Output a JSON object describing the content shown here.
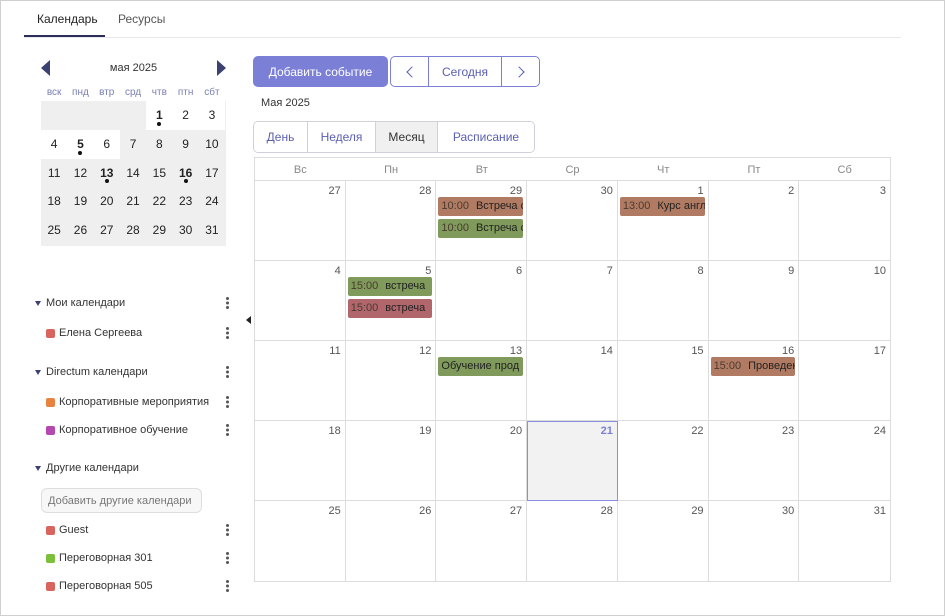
{
  "tabs": [
    {
      "label": "Календарь",
      "active": true
    },
    {
      "label": "Ресурсы",
      "active": false
    }
  ],
  "mini_calendar": {
    "title": "мая 2025",
    "weekdays": [
      "вск",
      "пнд",
      "втр",
      "срд",
      "чтв",
      "птн",
      "сбт"
    ],
    "days": [
      {
        "d": "",
        "cur": false
      },
      {
        "d": "",
        "cur": false
      },
      {
        "d": "",
        "cur": false
      },
      {
        "d": "",
        "cur": false
      },
      {
        "d": "1",
        "cur": true,
        "bold": true,
        "dot": true
      },
      {
        "d": "2",
        "cur": true
      },
      {
        "d": "3",
        "cur": true
      },
      {
        "d": "4",
        "cur": true
      },
      {
        "d": "5",
        "cur": true,
        "bold": true,
        "dot": true
      },
      {
        "d": "6",
        "cur": true
      },
      {
        "d": "7",
        "cur": false
      },
      {
        "d": "8",
        "cur": false
      },
      {
        "d": "9",
        "cur": false
      },
      {
        "d": "10",
        "cur": false
      },
      {
        "d": "11",
        "cur": false
      },
      {
        "d": "12",
        "cur": false
      },
      {
        "d": "13",
        "cur": false,
        "bold": true,
        "dot": true
      },
      {
        "d": "14",
        "cur": false
      },
      {
        "d": "15",
        "cur": false
      },
      {
        "d": "16",
        "cur": false,
        "bold": true,
        "dot": true
      },
      {
        "d": "17",
        "cur": false
      },
      {
        "d": "18",
        "cur": false
      },
      {
        "d": "19",
        "cur": false
      },
      {
        "d": "20",
        "cur": false
      },
      {
        "d": "21",
        "cur": false
      },
      {
        "d": "22",
        "cur": false
      },
      {
        "d": "23",
        "cur": false
      },
      {
        "d": "24",
        "cur": false
      },
      {
        "d": "25",
        "cur": false
      },
      {
        "d": "26",
        "cur": false
      },
      {
        "d": "27",
        "cur": false
      },
      {
        "d": "28",
        "cur": false
      },
      {
        "d": "29",
        "cur": false
      },
      {
        "d": "30",
        "cur": false
      },
      {
        "d": "31",
        "cur": false
      }
    ]
  },
  "sections": {
    "my": {
      "label": "Мои календари",
      "items": [
        {
          "label": "Елена Сергеева",
          "color": "#d9645e"
        }
      ]
    },
    "directum": {
      "label": "Directum календари",
      "items": [
        {
          "label": "Корпоративные мероприятия",
          "color": "#e8833f"
        },
        {
          "label": "Корпоративное обучение",
          "color": "#b548b0"
        }
      ]
    },
    "other": {
      "label": "Другие календари",
      "add_placeholder": "Добавить другие календари",
      "items": [
        {
          "label": "Guest",
          "color": "#d9645e"
        },
        {
          "label": "Переговорная 301",
          "color": "#7cbf3a"
        },
        {
          "label": "Переговорная 505",
          "color": "#d9645e"
        }
      ]
    }
  },
  "toolbar": {
    "add_event": "Добавить событие",
    "today": "Сегодня",
    "period_label": "Мая 2025"
  },
  "views": [
    {
      "label": "День",
      "active": false
    },
    {
      "label": "Неделя",
      "active": false
    },
    {
      "label": "Месяц",
      "active": true
    },
    {
      "label": "Расписание",
      "active": false
    }
  ],
  "month": {
    "weekdays": [
      "Вс",
      "Пн",
      "Вт",
      "Ср",
      "Чт",
      "Пт",
      "Сб"
    ],
    "today": "21",
    "days": [
      "27",
      "28",
      "29",
      "30",
      "1",
      "2",
      "3",
      "4",
      "5",
      "6",
      "7",
      "8",
      "9",
      "10",
      "11",
      "12",
      "13",
      "14",
      "15",
      "16",
      "17",
      "18",
      "19",
      "20",
      "21",
      "22",
      "23",
      "24",
      "25",
      "26",
      "27",
      "28",
      "29",
      "30",
      "31"
    ],
    "events": [
      {
        "cell": 2,
        "slot": 0,
        "time": "10:00",
        "title": "Встреча с",
        "color": "#b07b62"
      },
      {
        "cell": 2,
        "slot": 1,
        "time": "10:00",
        "title": "Встреча с",
        "color": "#7f9a5a"
      },
      {
        "cell": 4,
        "slot": 0,
        "time": "13:00",
        "title": "Курс англ",
        "color": "#b07b62"
      },
      {
        "cell": 8,
        "slot": 0,
        "time": "15:00",
        "title": "встреча",
        "color": "#7f9a5a"
      },
      {
        "cell": 8,
        "slot": 1,
        "time": "15:00",
        "title": "встреча",
        "color": "#b0666b"
      },
      {
        "cell": 16,
        "slot": 0,
        "time": "",
        "title": "Обучение прод",
        "color": "#7f9a5a"
      },
      {
        "cell": 19,
        "slot": 0,
        "time": "15:00",
        "title": "Проведен",
        "color": "#b07b62"
      }
    ]
  }
}
